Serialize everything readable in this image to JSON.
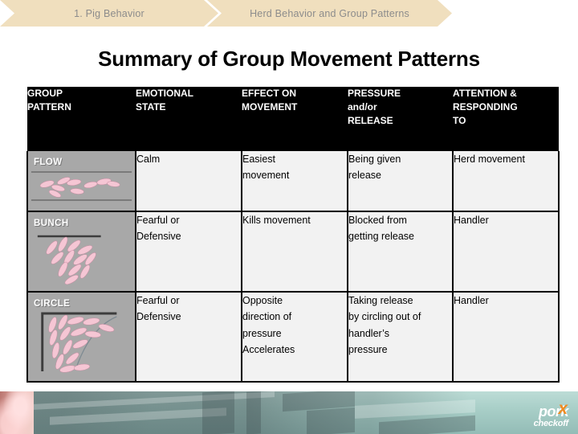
{
  "breadcrumb": {
    "items": [
      {
        "label": "1. Pig Behavior"
      },
      {
        "label": "Herd Behavior and Group Patterns"
      }
    ]
  },
  "page": {
    "title": "Summary of Group Movement Patterns"
  },
  "table": {
    "headers": [
      "GROUP PATTERN",
      "EMOTIONAL STATE",
      "EFFECT ON MOVEMENT",
      "PRESSURE and/or RELEASE",
      "ATTENTION & RESPONDING TO"
    ],
    "header_lines": [
      [
        "GROUP",
        "PATTERN"
      ],
      [
        "EMOTIONAL",
        "STATE"
      ],
      [
        "EFFECT ON",
        "MOVEMENT"
      ],
      [
        "PRESSURE",
        "and/or",
        "RELEASE"
      ],
      [
        "ATTENTION &",
        "RESPONDING",
        "TO"
      ]
    ],
    "rows": [
      {
        "pattern": "FLOW",
        "diagram": "pigs-flowing-in-alley-diagram",
        "emotional_state": [
          "Calm"
        ],
        "effect_on_movement": [
          "Easiest",
          "movement"
        ],
        "pressure_release": [
          "Being given",
          "release"
        ],
        "attention": [
          "Herd movement"
        ]
      },
      {
        "pattern": "BUNCH",
        "diagram": "pigs-bunched-at-wall-diagram",
        "emotional_state": [
          "Fearful or",
          "Defensive"
        ],
        "effect_on_movement": [
          "Kills movement"
        ],
        "pressure_release": [
          "Blocked from",
          "getting release"
        ],
        "attention": [
          "Handler"
        ]
      },
      {
        "pattern": "CIRCLE",
        "diagram": "pigs-circling-in-corner-diagram",
        "emotional_state": [
          "Fearful or",
          "Defensive"
        ],
        "effect_on_movement": [
          "Opposite",
          "direction of",
          "pressure",
          "Accelerates"
        ],
        "pressure_release": [
          "Taking release",
          "by circling out of",
          "handler’s",
          "pressure"
        ],
        "attention": [
          "Handler"
        ]
      }
    ]
  },
  "footer": {
    "logo_top": "pork",
    "logo_bottom": "checkoff",
    "logo_mark": "x"
  },
  "colors": {
    "breadcrumb_bg": "#f0dfbe",
    "breadcrumb_text": "#8c8c8c",
    "header_bg": "#000000",
    "header_text": "#ffffff",
    "cell_bg": "#f2f2f2",
    "diagram_bg": "#a8a8a8",
    "pig_fill": "#f5c6d4",
    "footer_teal": "#a9cfc8",
    "logo_accent": "#ef8b22"
  }
}
